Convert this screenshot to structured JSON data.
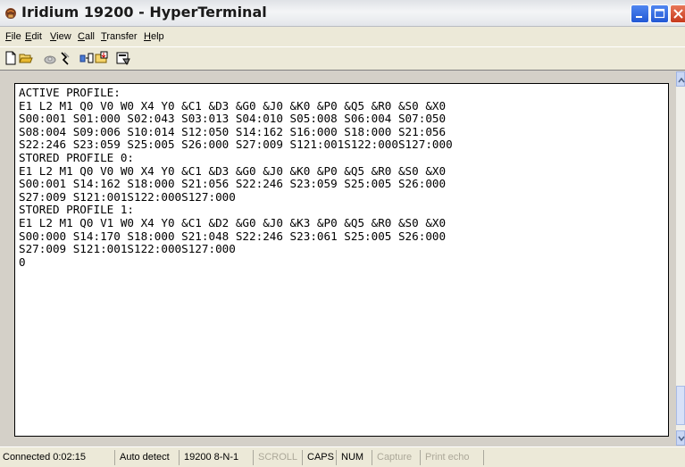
{
  "window": {
    "title": "Iridium 19200 - HyperTerminal",
    "app_icon": "hyperterminal-phone-icon"
  },
  "menu": [
    "File",
    "Edit",
    "View",
    "Call",
    "Transfer",
    "Help"
  ],
  "toolbar": {
    "icons": [
      "new-icon",
      "open-icon",
      "call-icon",
      "disconnect-icon",
      "send-icon",
      "receive-icon",
      "properties-icon"
    ]
  },
  "terminal": {
    "lines": [
      "ACTIVE PROFILE:",
      "E1 L2 M1 Q0 V0 W0 X4 Y0 &C1 &D3 &G0 &J0 &K0 &P0 &Q5 &R0 &S0 &X0",
      "S00:001 S01:000 S02:043 S03:013 S04:010 S05:008 S06:004 S07:050",
      "S08:004 S09:006 S10:014 S12:050 S14:162 S16:000 S18:000 S21:056",
      "S22:246 S23:059 S25:005 S26:000 S27:009 S121:001S122:000S127:000",
      "STORED PROFILE 0:",
      "E1 L2 M1 Q0 V0 W0 X4 Y0 &C1 &D3 &G0 &J0 &K0 &P0 &Q5 &R0 &S0 &X0",
      "S00:001 S14:162 S18:000 S21:056 S22:246 S23:059 S25:005 S26:000",
      "S27:009 S121:001S122:000S127:000",
      "STORED PROFILE 1:",
      "E1 L2 M1 Q0 V1 W0 X4 Y0 &C1 &D2 &G0 &J0 &K3 &P0 &Q5 &R0 &S0 &X0",
      "S00:000 S14:170 S18:000 S21:048 S22:246 S23:061 S25:005 S26:000",
      "S27:009 S121:001S122:000S127:000",
      "0"
    ]
  },
  "status": {
    "connected": "Connected 0:02:15",
    "detect": "Auto detect",
    "port": "19200 8-N-1",
    "scroll": "SCROLL",
    "caps": "CAPS",
    "num": "NUM",
    "capture": "Capture",
    "print_echo": "Print echo"
  },
  "colors": {
    "title_bg": "#e6e8eb",
    "chrome": "#ece9d8",
    "terminal_bg": "#ffffff",
    "close_button": "#c6391c",
    "min_max_button": "#2258d4"
  }
}
